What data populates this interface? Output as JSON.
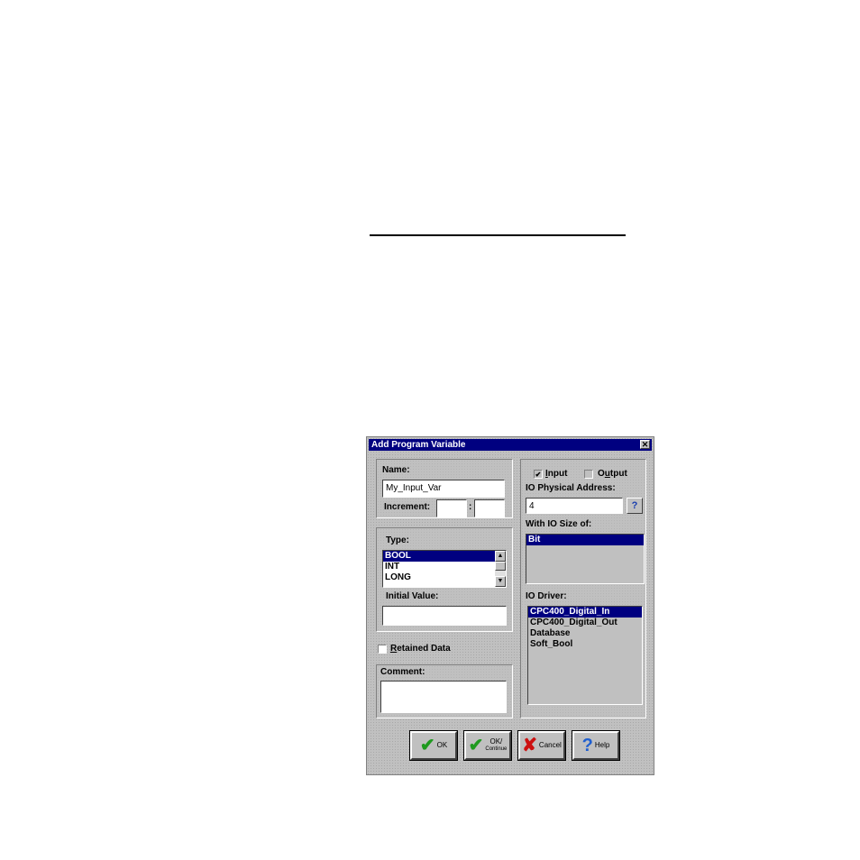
{
  "dialog": {
    "title": "Add Program Variable",
    "close_glyph": "✕"
  },
  "left": {
    "name_label": "Name:",
    "name_value": "My_Input_Var",
    "increment_label": "Increment:",
    "increment_sep": ":",
    "increment_a": "",
    "increment_b": "",
    "type_label": "Type:",
    "type_items": [
      "BOOL",
      "INT",
      "LONG"
    ],
    "type_selected": "BOOL",
    "initial_value_label": "Initial Value:",
    "initial_value": "",
    "retained_label": "Retained Data",
    "retained_checked": false,
    "comment_label": "Comment:",
    "comment_value": ""
  },
  "right": {
    "input_label": "Input",
    "input_checked": true,
    "output_label": "Output",
    "output_checked": false,
    "io_address_label": "IO Physical Address:",
    "io_address_value": "4",
    "io_size_label": "With IO Size of:",
    "io_size_items": [
      "Bit"
    ],
    "io_size_selected": "Bit",
    "io_driver_label": "IO Driver:",
    "io_driver_items": [
      "CPC400_Digital_In",
      "CPC400_Digital_Out",
      "Database",
      "Soft_Bool"
    ],
    "io_driver_selected": "CPC400_Digital_In"
  },
  "buttons": {
    "ok": "OK",
    "ok_continue_top": "OK/",
    "ok_continue_bottom": "Continue",
    "cancel": "Cancel",
    "help": "Help"
  },
  "icons": {
    "check_mark": "✔",
    "cross_mark": "✘",
    "question_mark": "?"
  }
}
